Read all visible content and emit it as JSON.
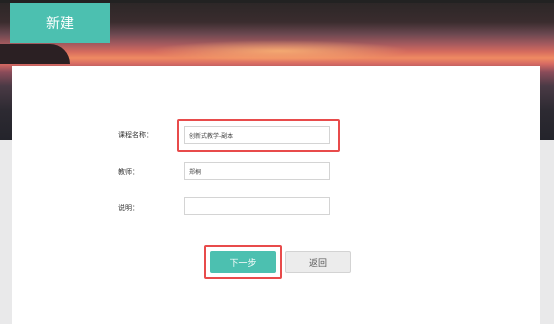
{
  "header": {
    "tab_label": "新建"
  },
  "form": {
    "course_name_label": "课程名称：",
    "course_name_value": "创新式教学-副本",
    "teacher_label": "教师：",
    "teacher_value": "郑桐",
    "description_label": "说明：",
    "description_value": ""
  },
  "actions": {
    "next_label": "下一步",
    "back_label": "返回"
  },
  "colors": {
    "accent": "#4cc0b0",
    "highlight": "#e84b4b"
  }
}
